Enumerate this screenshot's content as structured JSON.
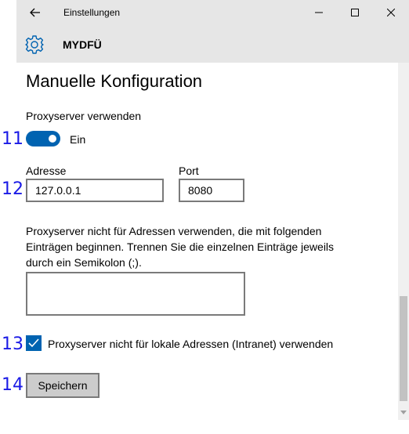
{
  "window": {
    "title": "Einstellungen",
    "controls": [
      "minimize",
      "maximize",
      "close"
    ]
  },
  "app": {
    "name": "MYDFÜ",
    "icon": "gear-icon"
  },
  "page": {
    "title": "Manuelle Konfiguration"
  },
  "proxy": {
    "use_label": "Proxyserver verwenden",
    "toggle_on": true,
    "toggle_state": "Ein",
    "address_label": "Adresse",
    "address_value": "127.0.0.1",
    "port_label": "Port",
    "port_value": "8080",
    "exceptions_description": "Proxyserver nicht für Adressen verwenden, die mit folgenden Einträgen beginnen. Trennen Sie die einzelnen Einträge jeweils durch ein Semikolon (;).",
    "exceptions_value": "",
    "bypass_local_checked": true,
    "bypass_local_label": "Proxyserver nicht für lokale Adressen (Intranet) verwenden",
    "save_label": "Speichern"
  },
  "annotations": {
    "marker_11": "11",
    "marker_12": "12",
    "marker_13": "13",
    "marker_14": "14"
  },
  "colors": {
    "accent": "#0063b1",
    "titlebar_bg": "#e6e6e6",
    "marker": "#1a1ae6"
  }
}
